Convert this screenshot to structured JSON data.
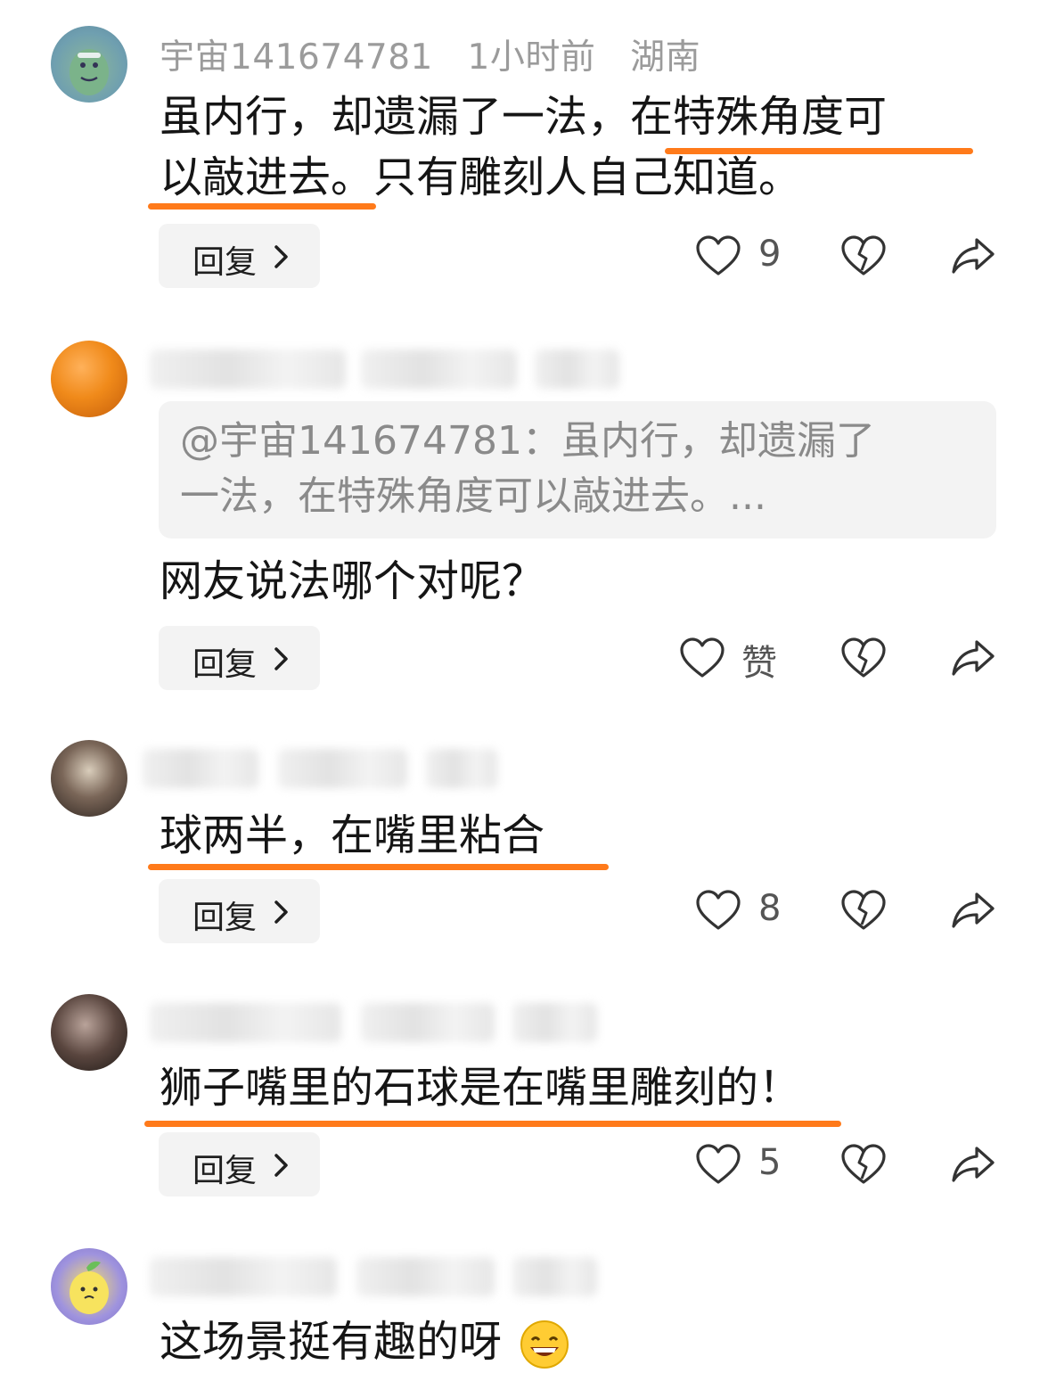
{
  "comments": [
    {
      "user": "宇宙141674781",
      "time": "1小时前",
      "region": "湖南",
      "lines": [
        "虽内行，却遗漏了一法，在特殊角度可",
        "以敲进去。只有雕刻人自己知道。"
      ],
      "reply_label": "回复",
      "like_count": "9"
    },
    {
      "quote_lines": [
        "@宇宙141674781：虽内行，却遗漏了",
        "一法，在特殊角度可以敲进去。..."
      ],
      "lines": [
        "网友说法哪个对呢？"
      ],
      "reply_label": "回复",
      "like_count": "赞"
    },
    {
      "lines": [
        "球两半，在嘴里粘合"
      ],
      "reply_label": "回复",
      "like_count": "8"
    },
    {
      "lines": [
        "狮子嘴里的石球是在嘴里雕刻的！"
      ],
      "reply_label": "回复",
      "like_count": "5"
    },
    {
      "lines": [
        "这场景挺有趣的呀"
      ]
    }
  ],
  "icons": {
    "like": "heart-outline-icon",
    "dislike": "broken-heart-icon",
    "share": "share-arrow-icon",
    "reply_chevron": "chevron-right-icon",
    "emoji": "grinning-face-icon"
  },
  "colors": {
    "highlight_underline": "#ff7a1a",
    "meta_text": "#9b9b9b",
    "button_bg": "#f3f3f3"
  }
}
